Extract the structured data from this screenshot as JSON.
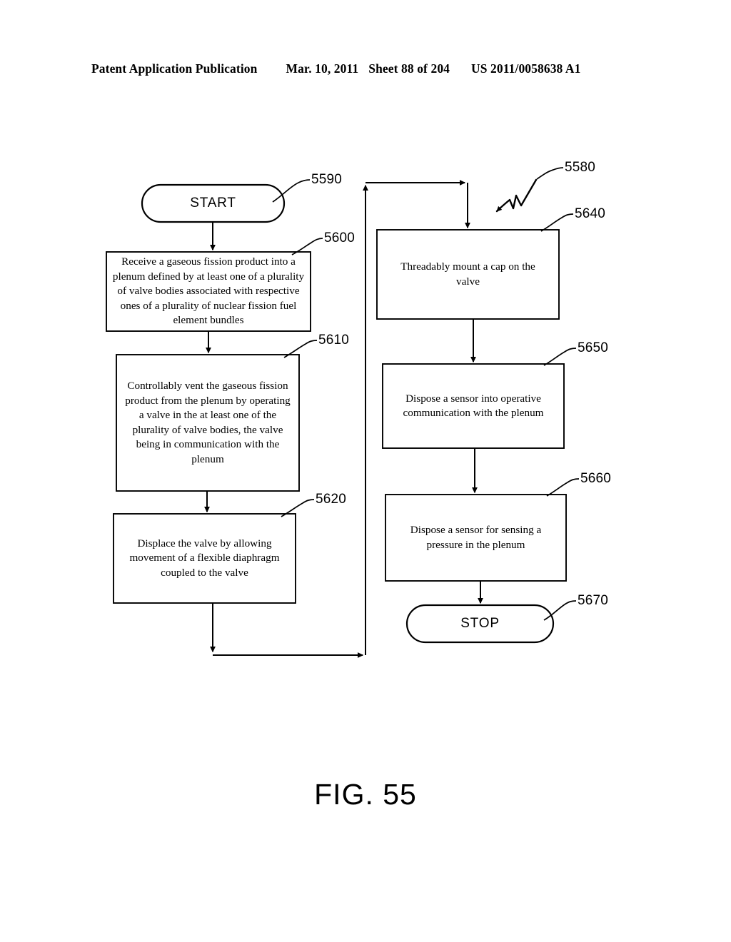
{
  "header": {
    "publication": "Patent Application Publication",
    "date": "Mar. 10, 2011",
    "sheet": "Sheet 88 of 204",
    "patent_number": "US 2011/0058638 A1"
  },
  "figure": {
    "caption": "FIG. 55",
    "diagram_reference": "5580"
  },
  "nodes": {
    "start": {
      "label": "START",
      "ref": "5590",
      "shape": "terminator"
    },
    "step_5600": {
      "label": "Receive a gaseous fission product into a plenum defined by at least one of a plurality of valve bodies associated with respective ones of a plurality of nuclear fission fuel element bundles",
      "ref": "5600",
      "shape": "process"
    },
    "step_5610": {
      "label": "Controllably vent the gaseous fission product from the plenum by operating a valve in the at least one of the plurality of valve bodies, the valve being in communication with the plenum",
      "ref": "5610",
      "shape": "process"
    },
    "step_5620": {
      "label": "Displace the valve by allowing movement of a flexible diaphragm coupled to the valve",
      "ref": "5620",
      "shape": "process"
    },
    "step_5640": {
      "label": "Threadably mount a cap on the valve",
      "ref": "5640",
      "shape": "process"
    },
    "step_5650": {
      "label": "Dispose a sensor into operative communication with the plenum",
      "ref": "5650",
      "shape": "process"
    },
    "step_5660": {
      "label": "Dispose a sensor for sensing a pressure in the plenum",
      "ref": "5660",
      "shape": "process"
    },
    "stop": {
      "label": "STOP",
      "ref": "5670",
      "shape": "terminator"
    }
  },
  "colors": {
    "ink": "#000000",
    "paper": "#ffffff"
  }
}
